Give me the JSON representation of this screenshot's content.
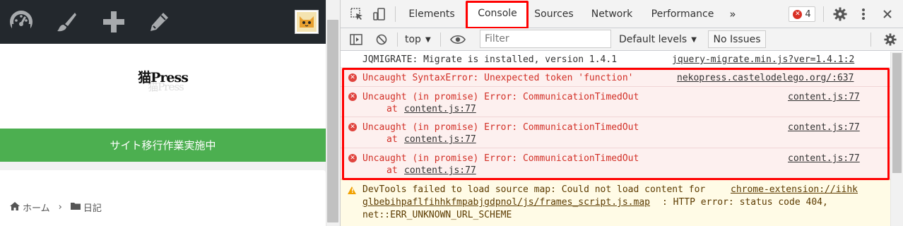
{
  "site": {
    "title": "猫Press",
    "title_shadow": "猫Press",
    "banner": "サイト移行作業実施中",
    "breadcrumb": {
      "home": "ホーム",
      "separator": "›",
      "category": "日記"
    },
    "admin_icons": [
      "dashboard-icon",
      "brush-icon",
      "plus-icon",
      "pencil-icon"
    ],
    "banner_color": "#4caf50",
    "admin_bar_color": "#23282d"
  },
  "devtools": {
    "tabs": [
      "Elements",
      "Console",
      "Sources",
      "Network",
      "Performance"
    ],
    "active_tab": "Console",
    "more_tabs": "»",
    "error_count": "4",
    "context": "top",
    "filter_placeholder": "Filter",
    "levels": "Default levels",
    "issues": "No Issues",
    "accent_color": "#1a73e8",
    "error_color": "#d22f26",
    "highlight_color": "#ff0000"
  },
  "console": {
    "info": {
      "text": "JQMIGRATE: Migrate is installed, version 1.4.1",
      "source": "jquery-migrate.min.js?ver=1.4.1:2"
    },
    "errors": [
      {
        "text": "Uncaught SyntaxError: Unexpected token 'function'",
        "source": "nekopress.castelodelego.org/:637"
      },
      {
        "text": "Uncaught (in promise) Error: CommunicationTimedOut",
        "at_prefix": "at ",
        "at_link": "content.js:77",
        "source": "content.js:77"
      },
      {
        "text": "Uncaught (in promise) Error: CommunicationTimedOut",
        "at_prefix": "at ",
        "at_link": "content.js:77",
        "source": "content.js:77"
      },
      {
        "text": "Uncaught (in promise) Error: CommunicationTimedOut",
        "at_prefix": "at ",
        "at_link": "content.js:77",
        "source": "content.js:77"
      }
    ],
    "warning": {
      "line1_prefix": "DevTools failed to load source map: Could not load content for ",
      "line1_link": "chrome-extension://iihk",
      "line2_link": "glbebihpaflfihhkfmpabjgdpnol/js/frames_script.js.map",
      "line2_suffix": ": HTTP error: status code 404,",
      "line3": "net::ERR_UNKNOWN_URL_SCHEME"
    }
  }
}
